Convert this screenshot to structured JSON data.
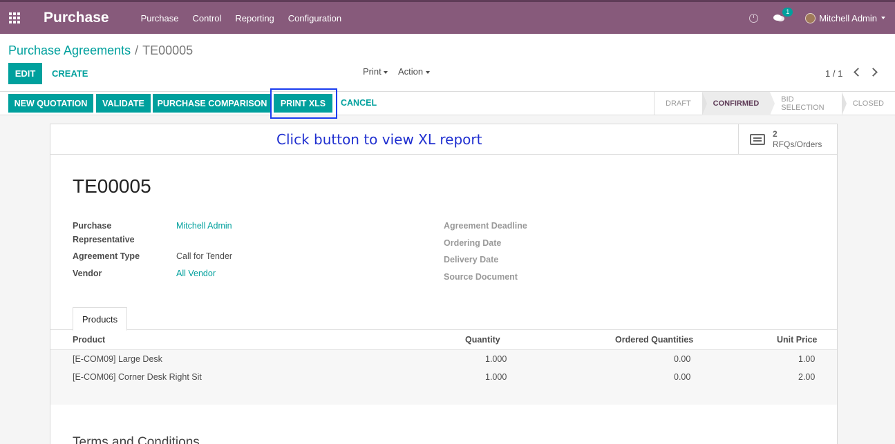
{
  "navbar": {
    "app_title": "Purchase",
    "menu": [
      "Purchase",
      "Control",
      "Reporting",
      "Configuration"
    ],
    "chat_count": "1",
    "user_name": "Mitchell Admin"
  },
  "breadcrumb": {
    "parent": "Purchase Agreements",
    "separator": "/",
    "current": "TE00005"
  },
  "control": {
    "edit_label": "EDIT",
    "create_label": "CREATE",
    "print_label": "Print",
    "action_label": "Action",
    "pager": "1 / 1"
  },
  "statusbar": {
    "buttons": [
      "NEW QUOTATION",
      "VALIDATE",
      "PURCHASE COMPARISON",
      "PRINT XLS"
    ],
    "cancel_label": "CANCEL",
    "stages": [
      "DRAFT",
      "CONFIRMED",
      "BID SELECTION",
      "CLOSED"
    ],
    "active_stage": "CONFIRMED"
  },
  "sheet": {
    "annotation": "Click button to view XL report",
    "smart_button": {
      "count": "2",
      "label": "RFQs/Orders"
    },
    "title": "TE00005",
    "left_fields": [
      {
        "label": "Purchase Representative",
        "value": "Mitchell Admin"
      },
      {
        "label": "Agreement Type",
        "value": "Call for Tender"
      },
      {
        "label": "Vendor",
        "value": "All Vendor"
      }
    ],
    "right_fields": [
      "Agreement Deadline",
      "Ordering Date",
      "Delivery Date",
      "Source Document"
    ],
    "tab": "Products",
    "table": {
      "headers": [
        "Product",
        "Quantity",
        "Ordered Quantities",
        "Unit Price"
      ],
      "rows": [
        [
          "[E-COM09] Large Desk",
          "1.000",
          "0.00",
          "1.00"
        ],
        [
          "[E-COM06] Corner Desk Right Sit",
          "1.000",
          "0.00",
          "2.00"
        ]
      ]
    },
    "terms_title": "Terms and Conditions"
  }
}
